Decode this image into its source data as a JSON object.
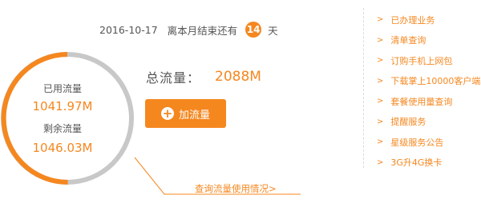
{
  "header": {
    "date": "2016-10-17",
    "countdown_prefix": "离本月结束还有",
    "days_left": "14",
    "days_unit": "天"
  },
  "usage": {
    "used_label": "已用流量",
    "used_value": "1041.97M",
    "remaining_label": "剩余流量",
    "remaining_value": "1046.03M",
    "used_fraction": 0.4988,
    "total_label": "总流量：",
    "total_value": "2088M",
    "add_button_label": "加流量",
    "query_link": "查询流量使用情况>"
  },
  "sidebar": {
    "arrow_glyph": ">",
    "items": [
      {
        "label": "已办理业务"
      },
      {
        "label": "清单查询"
      },
      {
        "label": "订购手机上网包"
      },
      {
        "label": "下载掌上10000客户端"
      },
      {
        "label": "套餐使用量查询"
      },
      {
        "label": "提醒服务"
      },
      {
        "label": "星级服务公告"
      },
      {
        "label": "3G升4G换卡"
      }
    ]
  },
  "colors": {
    "accent": "#f5871f",
    "ring_remaining": "#c8c8c8",
    "text": "#555555"
  }
}
